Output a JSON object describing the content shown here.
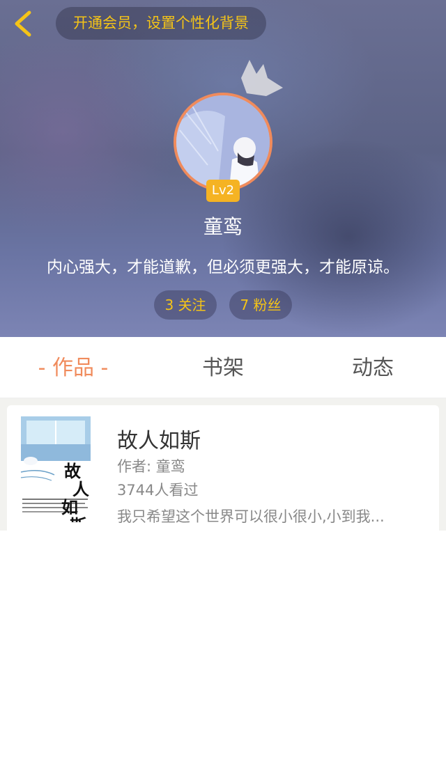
{
  "header": {
    "back_icon": "chevron-left-icon",
    "vip_text": "开通会员，设置个性化背景",
    "level": "Lv2",
    "username": "童鸾",
    "bio": "内心强大，才能道歉，但必须更强大，才能原谅。",
    "follow_text": "3 关注",
    "fans_text": "7 粉丝",
    "accent_color": "#f5c417",
    "avatar_border_color": "#f08b5c"
  },
  "tabs": [
    {
      "label": "- 作品 -",
      "active": true
    },
    {
      "label": "书架",
      "active": false
    },
    {
      "label": "动态",
      "active": false
    }
  ],
  "book": {
    "title": "故人如斯",
    "author": "作者: 童鸾",
    "views": "3744人看过",
    "description": "我只希望这个世界可以很小很小,小到我...",
    "cover_title_chars": [
      "故",
      "人",
      "如",
      "斯"
    ]
  },
  "colors": {
    "active_tab": "#f08b5c",
    "level_badge": "#f5b323"
  }
}
